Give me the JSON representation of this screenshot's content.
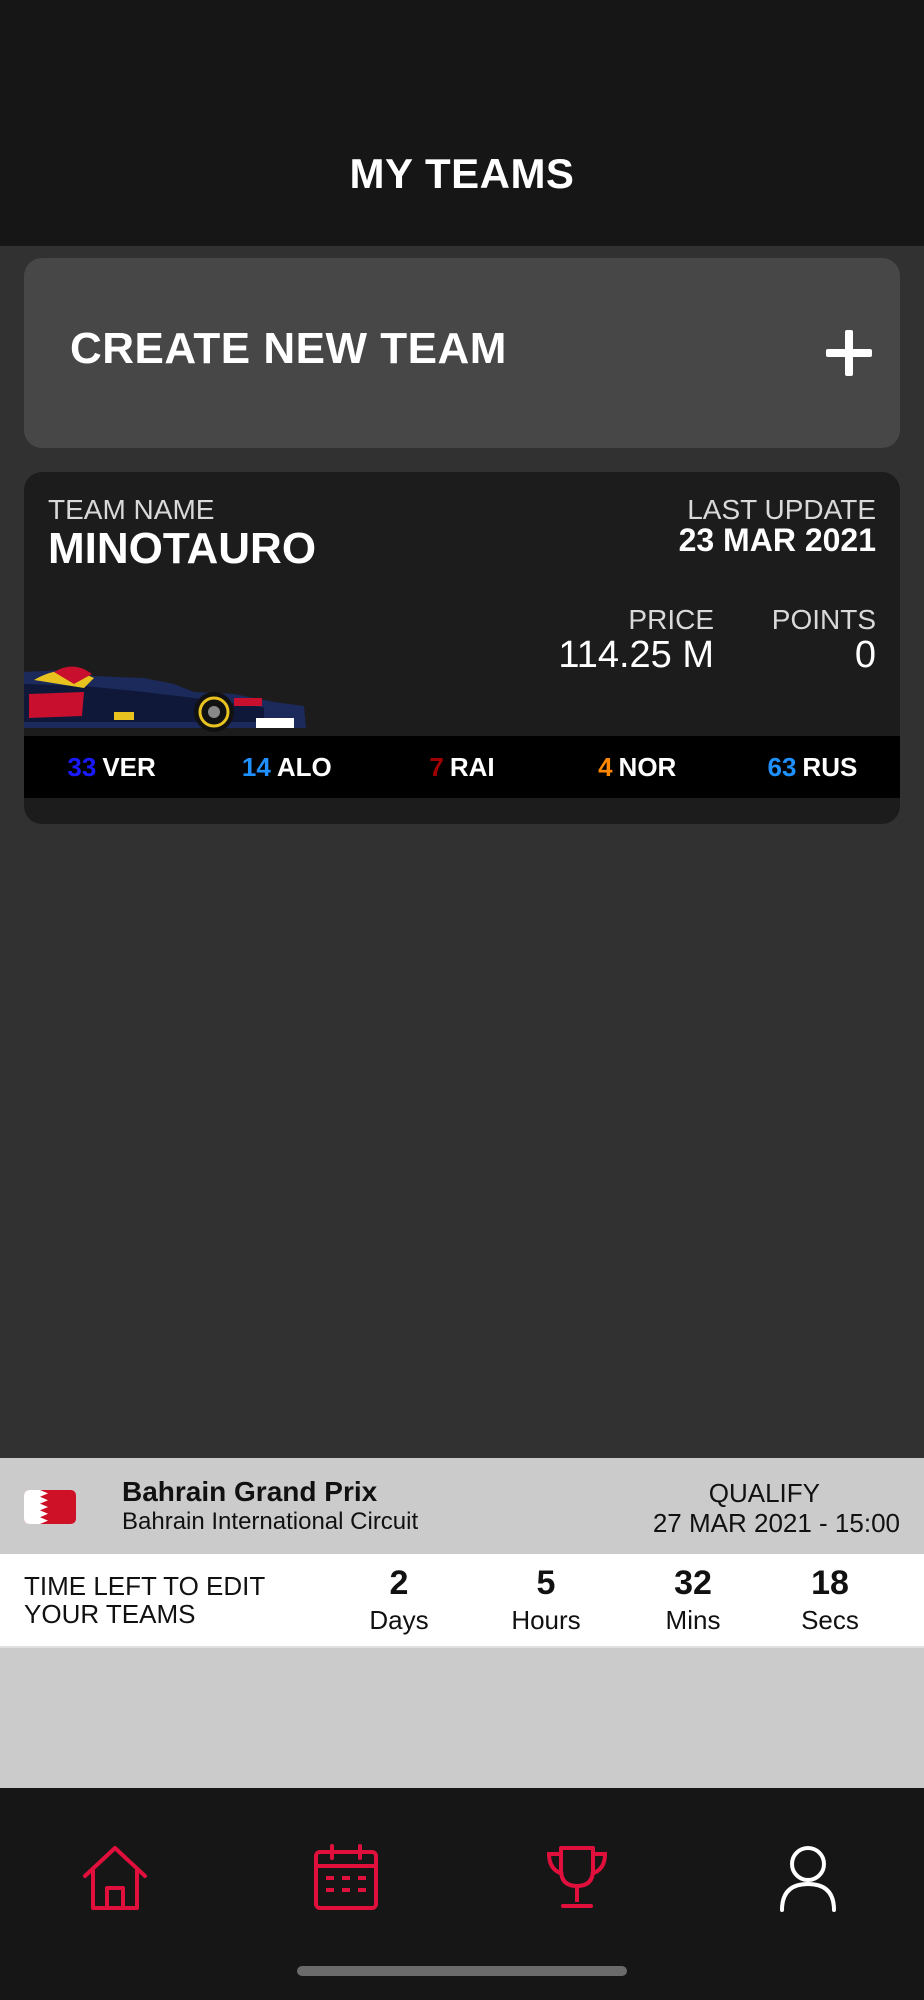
{
  "header": {
    "title": "MY TEAMS"
  },
  "create_team": {
    "label": "CREATE NEW TEAM",
    "icon": "plus-icon"
  },
  "team": {
    "name_label": "TEAM NAME",
    "name": "MINOTAURO",
    "last_update_label": "LAST UPDATE",
    "last_update": "23 MAR 2021",
    "price_label": "PRICE",
    "price": "114.25 M",
    "points_label": "POINTS",
    "points": "0",
    "drivers": [
      {
        "number": "33",
        "code": "VER",
        "color": "#1a1aff"
      },
      {
        "number": "14",
        "code": "ALO",
        "color": "#1e90ff"
      },
      {
        "number": "7",
        "code": "RAI",
        "color": "#a00000"
      },
      {
        "number": "4",
        "code": "NOR",
        "color": "#ff8700"
      },
      {
        "number": "63",
        "code": "RUS",
        "color": "#1e90ff"
      }
    ]
  },
  "race": {
    "name": "Bahrain Grand Prix",
    "circuit": "Bahrain International Circuit",
    "session": "QUALIFY",
    "datetime": "27 MAR 2021 - 15:00",
    "flag_icon": "bahrain-flag-icon"
  },
  "countdown": {
    "label": "TIME LEFT TO EDIT YOUR TEAMS",
    "days": "2",
    "days_label": "Days",
    "hours": "5",
    "hours_label": "Hours",
    "mins": "32",
    "mins_label": "Mins",
    "secs": "18",
    "secs_label": "Secs"
  },
  "tabbar": {
    "items": [
      {
        "icon": "home-icon",
        "active": false
      },
      {
        "icon": "calendar-icon",
        "active": false
      },
      {
        "icon": "trophy-icon",
        "active": false
      },
      {
        "icon": "profile-icon",
        "active": true
      }
    ],
    "accent_color": "#e10f3c"
  }
}
